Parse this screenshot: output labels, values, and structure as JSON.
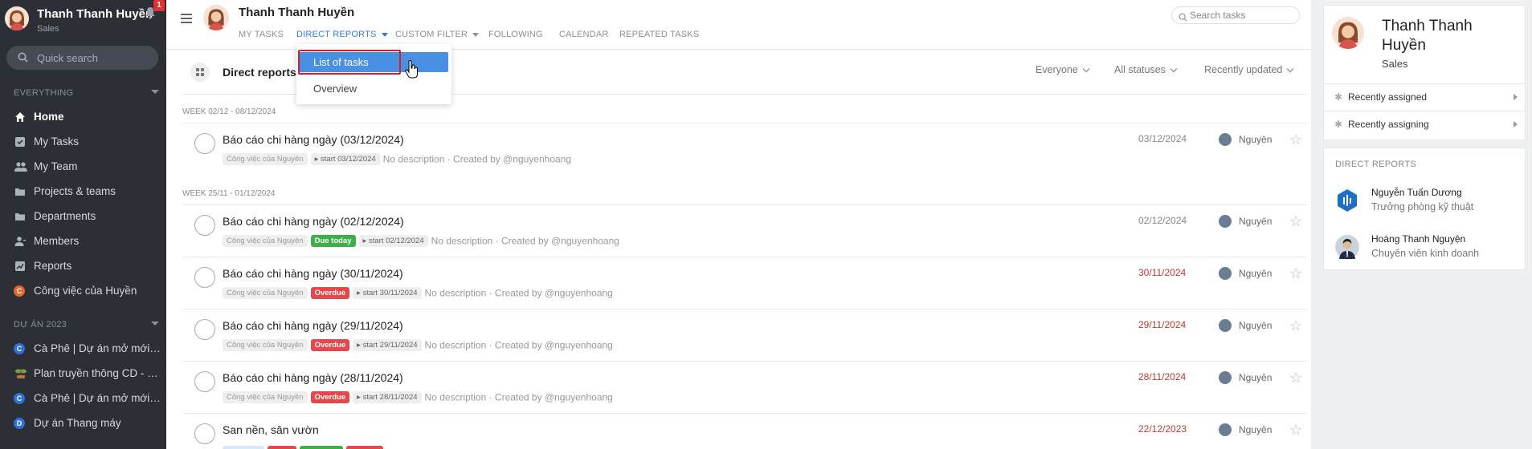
{
  "sidebar": {
    "user_name": "Thanh Thanh Huyền",
    "user_role": "Sales",
    "notification_count": "1",
    "search_placeholder": "Quick search",
    "section_everything": "EVERYTHING",
    "items": [
      {
        "label": "Home",
        "icon": "home-icon"
      },
      {
        "label": "My Tasks",
        "icon": "checkbox-icon"
      },
      {
        "label": "My Team",
        "icon": "team-icon"
      },
      {
        "label": "Projects & teams",
        "icon": "folder-icon"
      },
      {
        "label": "Departments",
        "icon": "folder-icon"
      },
      {
        "label": "Members",
        "icon": "members-icon"
      },
      {
        "label": "Reports",
        "icon": "chart-icon"
      },
      {
        "label": "Công việc của Huyền",
        "icon": "C"
      }
    ],
    "section_projects": "DỰ ÁN 2023",
    "projects": [
      {
        "label": "Cà Phê | Dự án mở mới c...",
        "initial": "C",
        "color": "#2f6fd6"
      },
      {
        "label": "Plan truyền thông CD - M...",
        "initial": "",
        "color": "#7a9e4a"
      },
      {
        "label": "Cà Phê | Dự án mở mới V...",
        "initial": "C",
        "color": "#2f6fd6"
      },
      {
        "label": "Dự án Thang máy",
        "initial": "D",
        "color": "#2f6fd6"
      }
    ]
  },
  "header": {
    "user_name": "Thanh Thanh Huyền",
    "tabs": [
      {
        "label": "MY TASKS"
      },
      {
        "label": "DIRECT REPORTS"
      },
      {
        "label": "CUSTOM FILTER"
      },
      {
        "label": "FOLLOWING"
      },
      {
        "label": "CALENDAR"
      },
      {
        "label": "REPEATED TASKS"
      }
    ],
    "search_placeholder": "Search tasks"
  },
  "dropdown": {
    "item1": "List of tasks",
    "item2": "Overview"
  },
  "main": {
    "title": "Direct reports",
    "filters": {
      "people": "Everyone",
      "status": "All statuses",
      "sort": "Recently updated"
    },
    "week1": "WEEK 02/12 - 08/12/2024",
    "week2": "WEEK 25/11 - 01/12/2024",
    "tasks": [
      {
        "title": "Báo cáo chi hàng ngày (03/12/2024)",
        "tag": "Công việc của Nguyên",
        "status": "",
        "start": "start 03/12/2024",
        "desc": "No description · Created by @nguyenhoang",
        "date": "03/12/2024",
        "user": "Nguyên"
      },
      {
        "title": "Báo cáo chi hàng ngày (02/12/2024)",
        "tag": "Công việc của Nguyên",
        "status": "Due today",
        "start": "start 02/12/2024",
        "desc": "No description · Created by @nguyenhoang",
        "date": "02/12/2024",
        "user": "Nguyên"
      },
      {
        "title": "Báo cáo chi hàng ngày (30/11/2024)",
        "tag": "Công việc của Nguyên",
        "status": "Overdue",
        "start": "start 30/11/2024",
        "desc": "No description · Created by @nguyenhoang",
        "date": "30/11/2024",
        "user": "Nguyên"
      },
      {
        "title": "Báo cáo chi hàng ngày (29/11/2024)",
        "tag": "Công việc của Nguyên",
        "status": "Overdue",
        "start": "start 29/11/2024",
        "desc": "No description · Created by @nguyenhoang",
        "date": "29/11/2024",
        "user": "Nguyên"
      },
      {
        "title": "Báo cáo chi hàng ngày (28/11/2024)",
        "tag": "Công việc của Nguyên",
        "status": "Overdue",
        "start": "start 28/11/2024",
        "desc": "No description · Created by @nguyenhoang",
        "date": "28/11/2024",
        "user": "Nguyên"
      },
      {
        "title": "San nền, sân vườn",
        "tag": "",
        "status": "",
        "start": "",
        "desc": "",
        "date": "22/12/2023",
        "user": "Nguyên"
      }
    ]
  },
  "right_panel": {
    "user_name": "Thanh Thanh Huyền",
    "user_role": "Sales",
    "row1": "Recently assigned",
    "row2": "Recently assigning",
    "section": "DIRECT REPORTS",
    "reports": [
      {
        "name": "Nguyễn Tuấn Dương",
        "role": "Trưởng phòng kỹ thuật"
      },
      {
        "name": "Hoàng Thanh Nguyện",
        "role": "Chuyên viên kinh doanh"
      }
    ]
  },
  "colors": {
    "sidebar_bg": "#2c2f36",
    "accent": "#3a7bd5",
    "overdue": "#e6474a",
    "due_today": "#3eb049",
    "highlight_box": "#e0182d"
  }
}
